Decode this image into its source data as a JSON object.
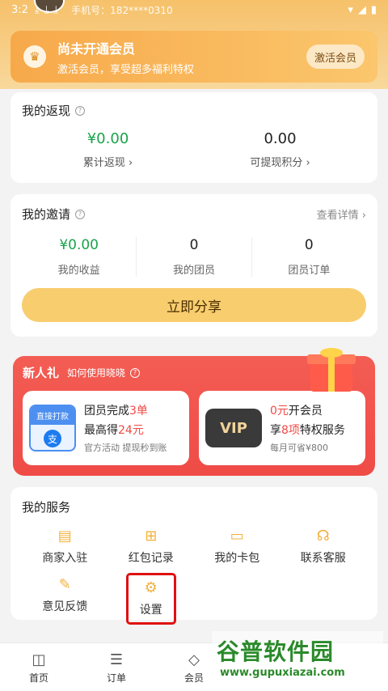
{
  "status": {
    "time": "3:2",
    "phone": "手机号：182****0310"
  },
  "vip": {
    "title": "尚未开通会员",
    "subtitle": "激活会员，享受超多福利特权",
    "button": "激活会员"
  },
  "cashback": {
    "title": "我的返现",
    "items": [
      {
        "value": "¥0.00",
        "label": "累计返现 ›"
      },
      {
        "value": "0.00",
        "label": "可提现积分 ›"
      }
    ]
  },
  "invite": {
    "title": "我的邀请",
    "more": "查看详情 ›",
    "items": [
      {
        "value": "¥0.00",
        "label": "我的收益"
      },
      {
        "value": "0",
        "label": "我的团员"
      },
      {
        "value": "0",
        "label": "团员订单"
      }
    ],
    "share": "立即分享"
  },
  "newbie": {
    "title": "新人礼",
    "help": "如何使用晓晓",
    "left": {
      "badge_top": "直接打款",
      "badge_icon": "支",
      "line1_a": "团员完成",
      "line1_b": "3单",
      "line2_a": "最高得",
      "line2_b": "24元",
      "note": "官方活动  提现秒到账"
    },
    "right": {
      "badge": "VIP",
      "line1_a": "0元",
      "line1_b": "开会员",
      "line2_a": "享",
      "line2_b": "8项",
      "line2_c": "特权服务",
      "note": "每月可省¥800"
    }
  },
  "services": {
    "title": "我的服务",
    "items": [
      {
        "label": "商家入驻",
        "icon": "store-icon"
      },
      {
        "label": "红包记录",
        "icon": "grid-icon"
      },
      {
        "label": "我的卡包",
        "icon": "wallet-icon"
      },
      {
        "label": "联系客服",
        "icon": "headset-icon"
      },
      {
        "label": "意见反馈",
        "icon": "edit-icon"
      },
      {
        "label": "设置",
        "icon": "gear-icon"
      }
    ]
  },
  "tabs": [
    {
      "label": "首页",
      "icon": "bag-icon"
    },
    {
      "label": "订单",
      "icon": "order-icon"
    },
    {
      "label": "会员",
      "icon": "diamond-icon"
    }
  ],
  "watermark": {
    "big": "谷普软件园",
    "small": "www.gupuxiazai.com"
  }
}
